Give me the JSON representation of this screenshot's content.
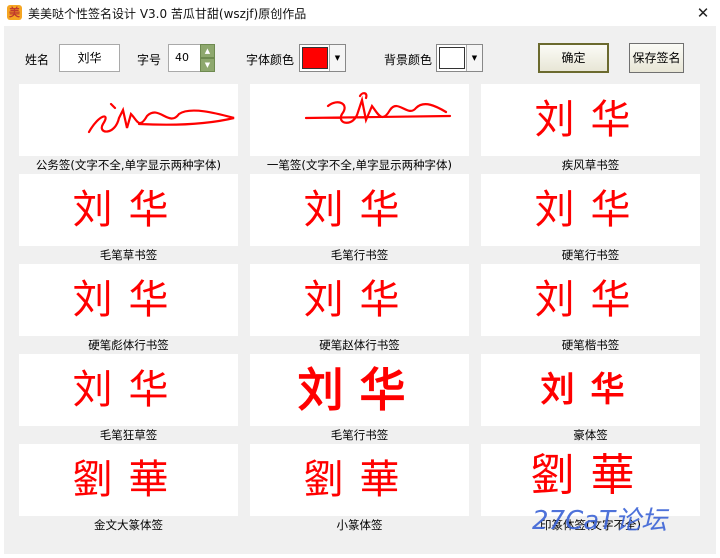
{
  "window": {
    "title": "美美哒个性签名设计 V3.0    苦瓜甘甜(wszjf)原创作品",
    "close_glyph": "✕"
  },
  "toolbar": {
    "name_label": "姓名",
    "name_value": "刘华",
    "size_label": "字号",
    "size_value": "40",
    "font_color_label": "字体颜色",
    "font_color": "#ff0000",
    "bg_color_label": "背景颜色",
    "bg_color": "#ffffff",
    "confirm_label": "确定",
    "save_label": "保存签名"
  },
  "signatures": [
    {
      "caption": "公务签(文字不全,单字显示两种字体)",
      "text": ""
    },
    {
      "caption": "一笔签(文字不全,单字显示两种字体)",
      "text": ""
    },
    {
      "caption": "疾风草书签",
      "text": "刘华"
    },
    {
      "caption": "毛笔草书签",
      "text": "刘华"
    },
    {
      "caption": "毛笔行书签",
      "text": "刘华"
    },
    {
      "caption": "硬笔行书签",
      "text": "刘华"
    },
    {
      "caption": "硬笔彪体行书签",
      "text": "刘华"
    },
    {
      "caption": "硬笔赵体行书签",
      "text": "刘华"
    },
    {
      "caption": "硬笔楷书签",
      "text": "刘华"
    },
    {
      "caption": "毛笔狂草签",
      "text": "刘华"
    },
    {
      "caption": "毛笔行书签",
      "text": "刘华"
    },
    {
      "caption": "豪体签",
      "text": "刘华"
    },
    {
      "caption": "金文大篆体签",
      "text": "劉華"
    },
    {
      "caption": "小篆体签",
      "text": "劉華"
    },
    {
      "caption": "印篆体签(文字不全)",
      "text": "劉華"
    }
  ],
  "watermark": "27CaT论坛"
}
